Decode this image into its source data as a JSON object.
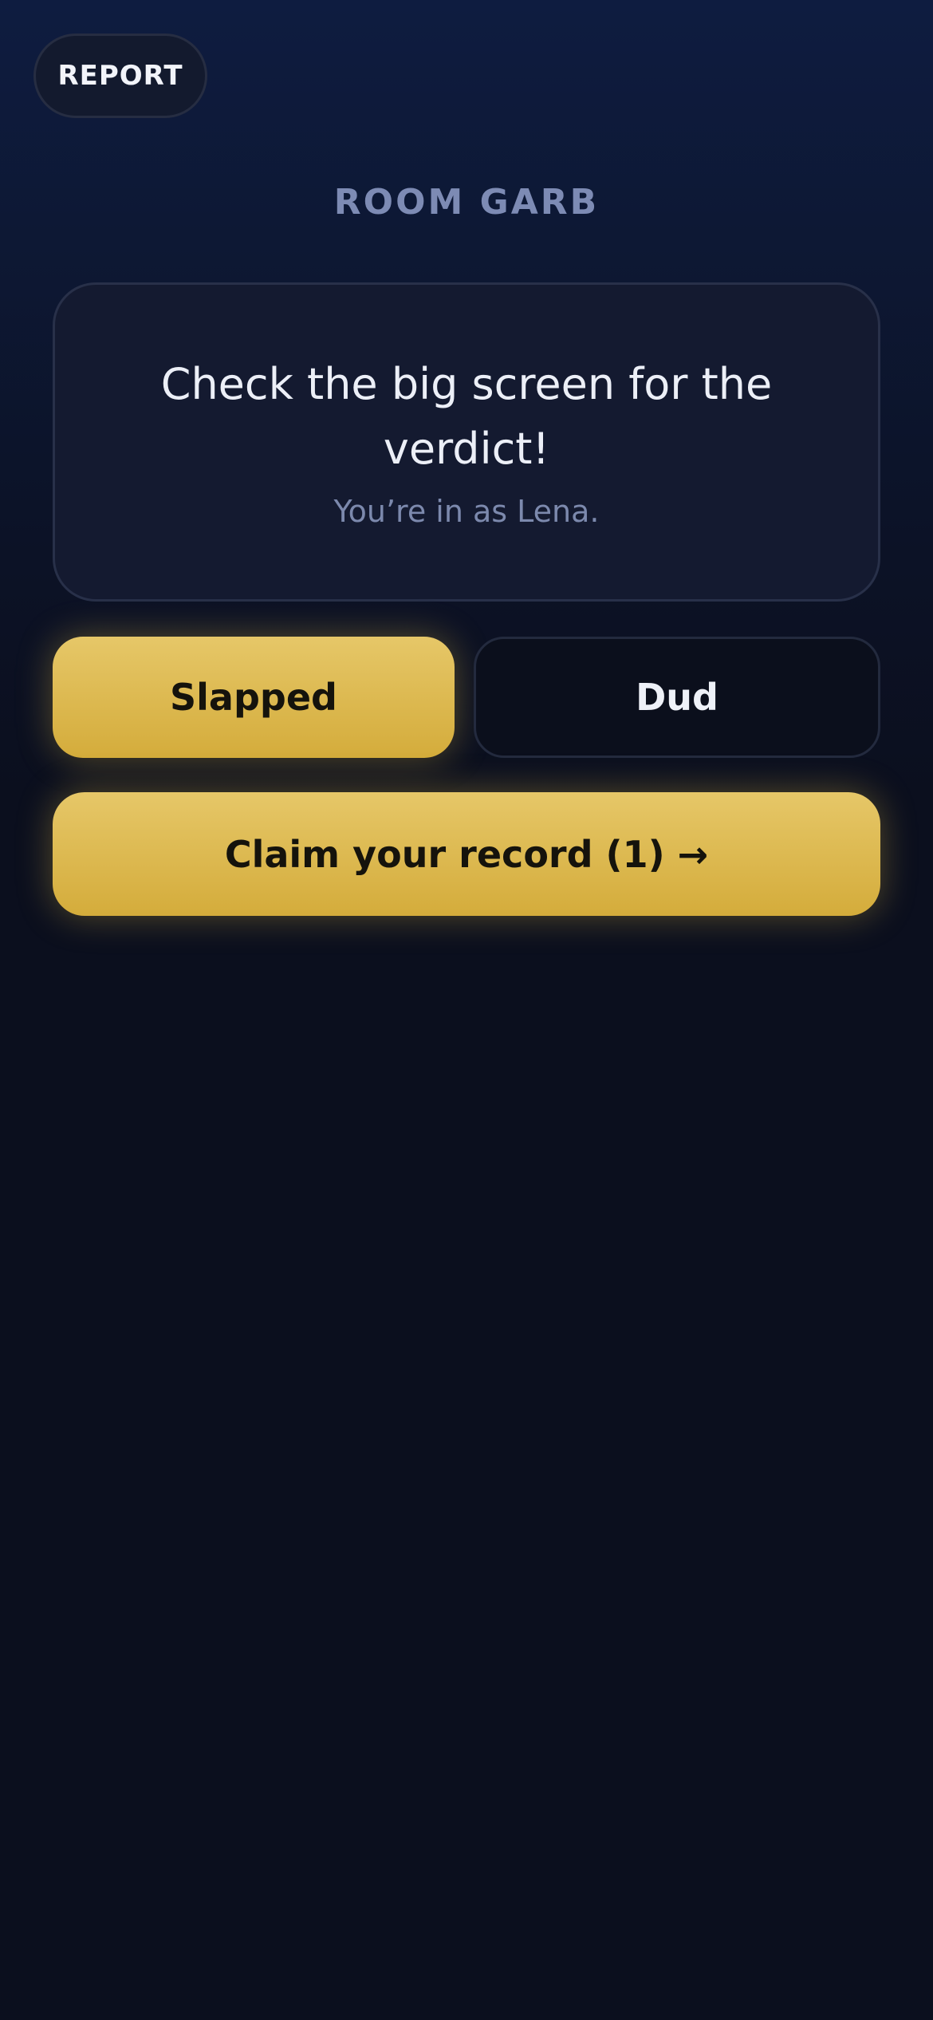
{
  "header": {
    "report_label": "REPORT"
  },
  "room": {
    "name": "ROOM GARB"
  },
  "card": {
    "message": "Check the big screen for the verdict!",
    "player_status": "You’re in as Lena."
  },
  "vote": {
    "slapped_label": "Slapped",
    "dud_label": "Dud"
  },
  "claim": {
    "label": "Claim your record (1) →"
  },
  "colors": {
    "accent_gold": "#e2c160",
    "background": "#0b0f1e",
    "muted_text": "#7c89ad"
  }
}
